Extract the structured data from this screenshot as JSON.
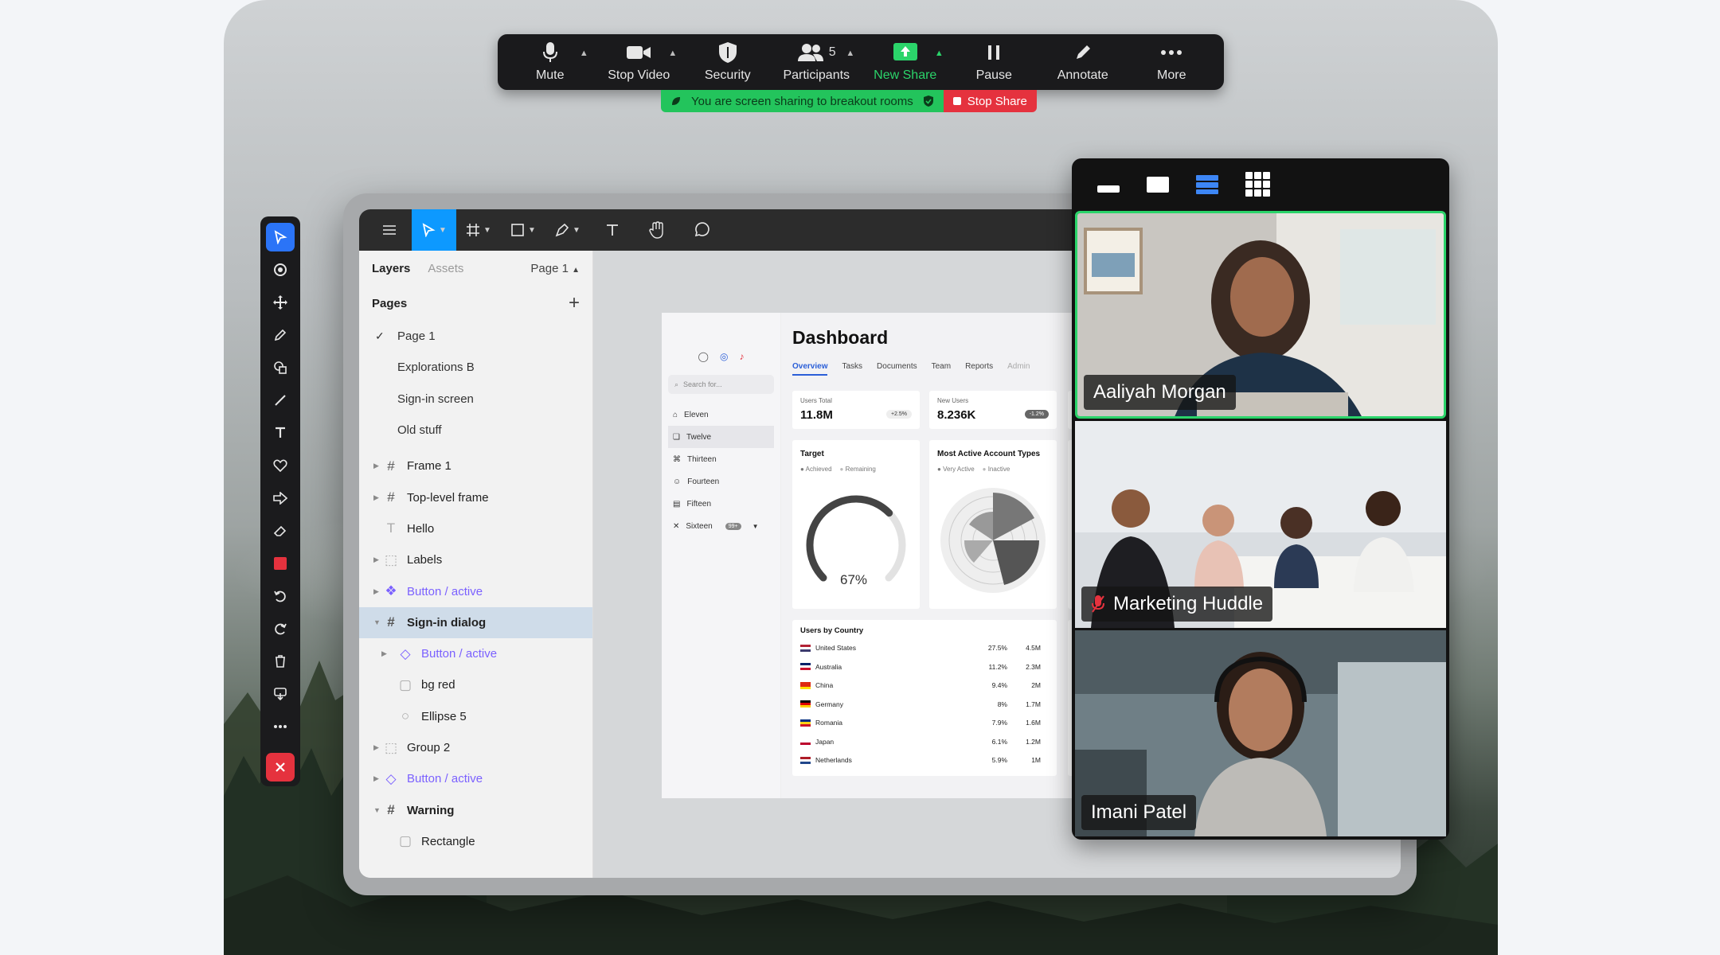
{
  "zoom_toolbar": {
    "mute": "Mute",
    "stop_video": "Stop Video",
    "security": "Security",
    "participants": "Participants",
    "participants_count": "5",
    "new_share": "New Share",
    "pause": "Pause",
    "annotate": "Annotate",
    "more": "More"
  },
  "share_banner": {
    "message": "You are screen sharing to breakout rooms",
    "stop": "Stop Share"
  },
  "figma": {
    "layers_tab": "Layers",
    "assets_tab": "Assets",
    "page_selector": "Page 1",
    "pages_heading": "Pages",
    "pages": [
      "Page 1",
      "Explorations B",
      "Sign-in screen",
      "Old stuff"
    ],
    "layers": [
      {
        "label": "Frame 1"
      },
      {
        "label": "Top-level frame"
      },
      {
        "label": "Hello"
      },
      {
        "label": "Labels"
      },
      {
        "label": "Button / active"
      },
      {
        "label": "Sign-in dialog"
      },
      {
        "label": "Button / active"
      },
      {
        "label": "bg red"
      },
      {
        "label": "Ellipse 5"
      },
      {
        "label": "Group 2"
      },
      {
        "label": "Button / active"
      },
      {
        "label": "Warning"
      },
      {
        "label": "Rectangle"
      }
    ]
  },
  "dashboard": {
    "title": "Dashboard",
    "search_placeholder": "Search for...",
    "nav": [
      "Eleven",
      "Twelve",
      "Thirteen",
      "Fourteen",
      "Fifteen",
      "Sixteen"
    ],
    "nav_badge": "99+",
    "tabs": [
      "Overview",
      "Tasks",
      "Documents",
      "Team",
      "Reports",
      "Admin"
    ],
    "users_total_label": "Users Total",
    "users_total_value": "11.8M",
    "users_total_change": "+2.5%",
    "new_users_label": "New Users",
    "new_users_value": "8.236K",
    "new_users_change": "-1.2%",
    "target_title": "Target",
    "target_legend": [
      "Achieved",
      "Remaining"
    ],
    "target_value": "67%",
    "target_fraction": 0.67,
    "active_title": "Most Active Account Types",
    "active_legend": [
      "Very Active",
      "Inactive"
    ],
    "countries_title": "Users by Country",
    "countries": [
      {
        "name": "United States",
        "pct": "27.5%",
        "num": "4.5M"
      },
      {
        "name": "Australia",
        "pct": "11.2%",
        "num": "2.3M"
      },
      {
        "name": "China",
        "pct": "9.4%",
        "num": "2M"
      },
      {
        "name": "Germany",
        "pct": "8%",
        "num": "1.7M"
      },
      {
        "name": "Romania",
        "pct": "7.9%",
        "num": "1.6M"
      },
      {
        "name": "Japan",
        "pct": "6.1%",
        "num": "1.2M"
      },
      {
        "name": "Netherlands",
        "pct": "5.9%",
        "num": "1M"
      }
    ]
  },
  "video": {
    "participants": [
      {
        "name": "Aaliyah Morgan"
      },
      {
        "name": "Marketing Huddle"
      },
      {
        "name": "Imani Patel"
      }
    ]
  },
  "colors": {
    "zoom_green": "#2bd46a",
    "stop_red": "#e5323e",
    "figma_blue": "#0d99ff",
    "component_purple": "#7b61ff"
  }
}
